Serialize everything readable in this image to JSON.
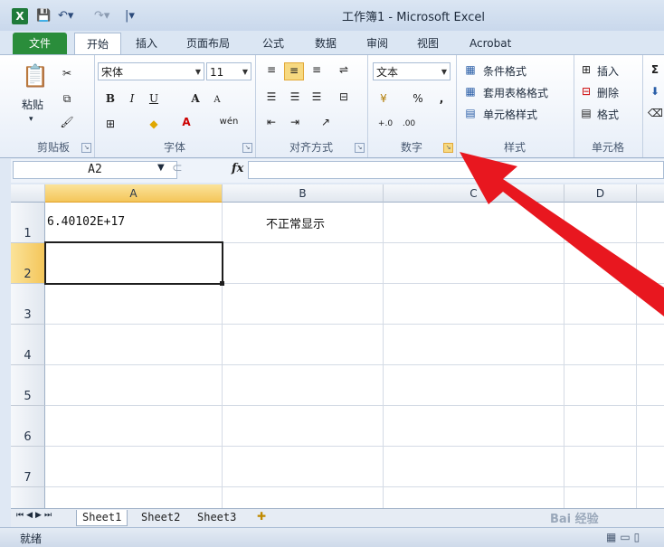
{
  "titlebar": {
    "logo": "X",
    "title": "工作簿1 - Microsoft Excel",
    "quick_access": [
      "save-icon",
      "undo-icon",
      "redo-icon",
      "customize-icon"
    ]
  },
  "tabs": [
    "文件",
    "开始",
    "插入",
    "页面布局",
    "公式",
    "数据",
    "审阅",
    "视图",
    "Acrobat"
  ],
  "ribbon": {
    "clipboard": {
      "paste": "粘贴",
      "label": "剪贴板"
    },
    "font": {
      "name": "宋体",
      "size": "11",
      "bold": "B",
      "italic": "I",
      "underline": "U",
      "label": "字体",
      "grow": "A",
      "shrink": "A",
      "phonetic": "wén"
    },
    "alignment": {
      "label": "对齐方式"
    },
    "number": {
      "format": "文本",
      "percent": "%",
      "comma": ",",
      "inc": "+.0",
      "dec": ".00",
      "label": "数字"
    },
    "styles": {
      "conditional": "条件格式",
      "table": "套用表格格式",
      "cell": "单元格样式",
      "label": "样式"
    },
    "cells": {
      "insert": "插入",
      "delete": "删除",
      "format": "格式",
      "label": "单元格"
    },
    "editing": {
      "sigma": "Σ"
    }
  },
  "formula_bar": {
    "name_box": "A2",
    "fx": "fx",
    "value": ""
  },
  "columns": [
    "A",
    "B",
    "C",
    "D"
  ],
  "rows": [
    "1",
    "2",
    "3",
    "4",
    "5",
    "6",
    "7"
  ],
  "cells": {
    "A1": "6.40102E+17",
    "B1": "不正常显示"
  },
  "sheets": [
    "Sheet1",
    "Sheet2",
    "Sheet3"
  ],
  "status": {
    "ready": "就绪"
  },
  "watermark": "Bai 经验",
  "colors": {
    "file_tab": "#2a8d3b",
    "selection_header": "#f4c65a",
    "arrow": "#e8171f"
  }
}
